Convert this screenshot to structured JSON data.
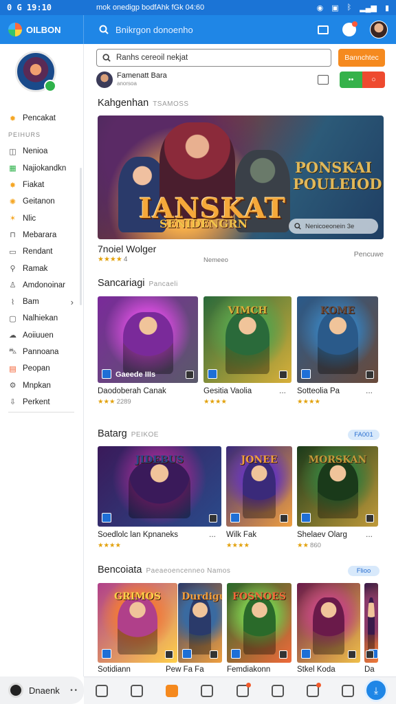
{
  "status_bar": {
    "time": "0 G  19:10",
    "center": "mok onedigp bodfAhk  fGk 04:60",
    "right_icons": [
      "location-icon",
      "sim-icon",
      "bluetooth-icon",
      "signal-icon",
      "battery-icon"
    ]
  },
  "app": {
    "brand": "OILBON",
    "search_placeholder": "Bnikrgon donoenho"
  },
  "sidebar": {
    "section_label": "PEIHURS",
    "items": [
      {
        "label": "Pencakat",
        "icon": "sun-icon",
        "color": "#f5a623"
      },
      {
        "label": "Nenioa",
        "icon": "tag-icon",
        "color": "#555"
      },
      {
        "label": "Najiokandkn",
        "icon": "grid-icon",
        "color": "#2fb24b"
      },
      {
        "label": "Fiakat",
        "icon": "star-icon",
        "color": "#f5a623"
      },
      {
        "label": "Geitanon",
        "icon": "gear-icon",
        "color": "#f5a623"
      },
      {
        "label": "Nlic",
        "icon": "sparkle-icon",
        "color": "#f5a623"
      },
      {
        "label": "Mebarara",
        "icon": "bookmark-icon",
        "color": "#555"
      },
      {
        "label": "Rendant",
        "icon": "monitor-icon",
        "color": "#555"
      },
      {
        "label": "Ramak",
        "icon": "search-icon",
        "color": "#555"
      },
      {
        "label": "Amdonoinar",
        "icon": "person-icon",
        "color": "#555"
      },
      {
        "label": "Bam",
        "icon": "tools-icon",
        "color": "#555",
        "chevron": "›"
      },
      {
        "label": "Nalhiekan",
        "icon": "box-icon",
        "color": "#555"
      },
      {
        "label": "Aoiiuuen",
        "icon": "cloud-icon",
        "color": "#555"
      },
      {
        "label": "Pannoana",
        "icon": "cart-icon",
        "color": "#555"
      },
      {
        "label": "Peopan",
        "icon": "calendar-icon",
        "color": "#f25a2b"
      },
      {
        "label": "Mnpkan",
        "icon": "gear-outline-icon",
        "color": "#555"
      },
      {
        "label": "Perkent",
        "icon": "download-icon",
        "color": "#555"
      }
    ],
    "bottom_label": "Dnaenk",
    "bottom_dots": "• •"
  },
  "main": {
    "search_value": "Ranhs cereoil nekjat",
    "search_button": "Bannchtec",
    "creator_name": "Famenatt Bara",
    "creator_sub": "anorsoa",
    "pill_left": "••",
    "pill_right": "○",
    "featured_section": {
      "title": "Kahgenhan",
      "sub": "TSAMOSS"
    },
    "hero": {
      "title": "IANSKAT",
      "subtitle": "SENIDENGRN",
      "logo": "PONSKAI POULEIOD",
      "chip": "Nenicoeonein 3e"
    },
    "featured": {
      "title": "7noiel Wolger",
      "stars": "★★★★",
      "rating": "4",
      "meta": "Nemeeo",
      "right": "Pencuwe"
    },
    "section2": {
      "title": "Sancariagi",
      "sub": "Pancaeli",
      "cards": [
        {
          "caption": "Daodoberah Canak",
          "stars": "★★★",
          "count": "2289",
          "title": "",
          "label": "Gaeede IIIs",
          "colors": [
            "#7a2a9a",
            "#c64ad0",
            "#5a5a6a"
          ]
        },
        {
          "caption": "Gesitia Vaolia",
          "stars": "★★★★",
          "count": "",
          "title": "VIMCH",
          "label": "",
          "colors": [
            "#2a6a3a",
            "#5aa04a",
            "#d9b03a"
          ],
          "dots": "..."
        },
        {
          "caption": "Sotteolia Pa",
          "stars": "★★★★",
          "count": "",
          "title": "KOME",
          "label": "",
          "colors": [
            "#2a5a8a",
            "#3a7ab0",
            "#6a4a3a"
          ],
          "dots": "..."
        }
      ]
    },
    "section3": {
      "title": "Batarg",
      "sub": "PEIKOE",
      "badge": "FA001",
      "cards": [
        {
          "caption": "Soedlolc lan Kpnaneks",
          "stars": "★★★★",
          "count": "",
          "title": "JIDEBUS",
          "colors": [
            "#3a1a5a",
            "#8a2a8a",
            "#2a4a8a"
          ],
          "dots": "..."
        },
        {
          "caption": "Wilk Fak",
          "stars": "★★★★",
          "count": "",
          "title": "JONEE",
          "colors": [
            "#3a2a7a",
            "#6a3ab0",
            "#f0a040"
          ]
        },
        {
          "caption": "Shelaev Olarg",
          "stars": "★★",
          "count": "860",
          "title": "MORSKAN",
          "colors": [
            "#1a3a1a",
            "#3a7a3a",
            "#c09a3a"
          ],
          "dots": "..."
        }
      ]
    },
    "section4": {
      "title": "Bencoiata",
      "sub": "Paeaeoencenneo Namos",
      "badge": "Flioo",
      "cards": [
        {
          "caption": "Sotidiann",
          "title": "GRIMOS",
          "colors": [
            "#b0408a",
            "#f07a3a",
            "#ffd04a"
          ]
        },
        {
          "caption": "Pew Fa Fa",
          "title": "Durdigu",
          "colors": [
            "#2a3a6a",
            "#3a6aa0",
            "#f0a040"
          ]
        },
        {
          "caption": "Femdiakonn",
          "title": "FOSNOES",
          "colors": [
            "#2a6a2a",
            "#7ac04a",
            "#f06a3a"
          ]
        },
        {
          "caption": "Stkel Koda",
          "title": "",
          "colors": [
            "#6a1a4a",
            "#c04a7a",
            "#f0c04a"
          ]
        },
        {
          "caption": "Da",
          "title": "",
          "colors": [
            "#3a1a4a",
            "#8a3a6a",
            "#f07a3a"
          ]
        }
      ]
    }
  },
  "bottom_nav": {
    "icons": [
      "home-icon",
      "store-icon",
      "grid-icon",
      "chat-icon",
      "bell-icon",
      "bag-icon",
      "share-icon",
      "pen-icon"
    ],
    "active": "grid-icon",
    "fab": "⤓"
  }
}
